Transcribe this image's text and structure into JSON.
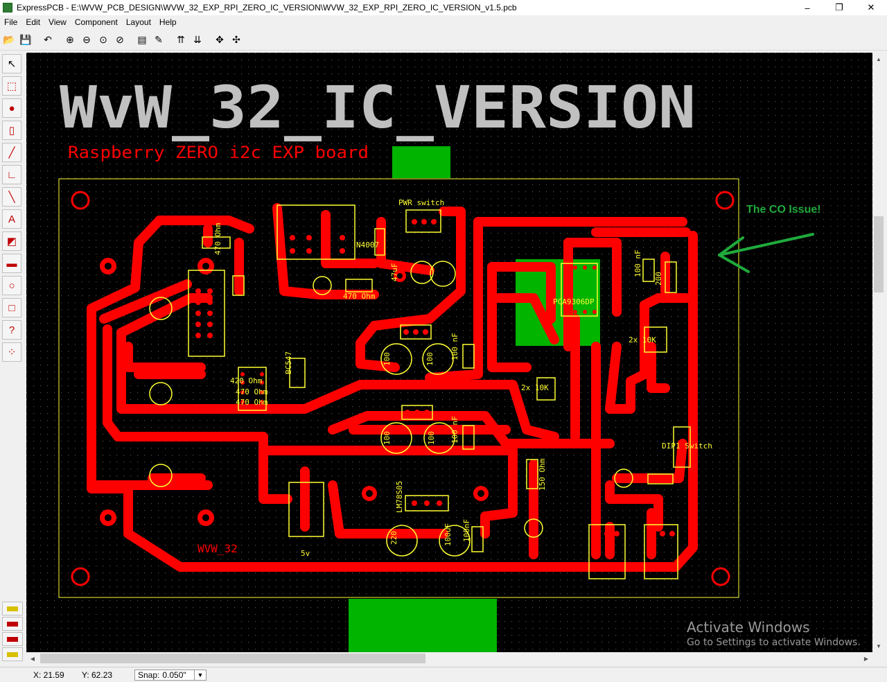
{
  "window": {
    "title": "ExpressPCB - E:\\WVW_PCB_DESIGN\\WVW_32_EXP_RPI_ZERO_IC_VERSION\\WVW_32_EXP_RPI_ZERO_IC_VERSION_v1.5.pcb",
    "minimize": "–",
    "maximize": "❐",
    "close": "✕"
  },
  "menu": [
    {
      "label": "File",
      "name": "menu-file"
    },
    {
      "label": "Edit",
      "name": "menu-edit"
    },
    {
      "label": "View",
      "name": "menu-view"
    },
    {
      "label": "Component",
      "name": "menu-component"
    },
    {
      "label": "Layout",
      "name": "menu-layout"
    },
    {
      "label": "Help",
      "name": "menu-help"
    }
  ],
  "toolbar": [
    {
      "icon": "open-folder-icon",
      "glyph": "📂"
    },
    {
      "icon": "save-icon",
      "glyph": "💾"
    },
    {
      "sep": true
    },
    {
      "icon": "undo-icon",
      "glyph": "↶"
    },
    {
      "sep": true
    },
    {
      "icon": "zoom-in-icon",
      "glyph": "⊕"
    },
    {
      "icon": "zoom-out-icon",
      "glyph": "⊖"
    },
    {
      "icon": "zoom-fit-icon",
      "glyph": "⊙"
    },
    {
      "icon": "zoom-previous-icon",
      "glyph": "⊘"
    },
    {
      "sep": true
    },
    {
      "icon": "properties-icon",
      "glyph": "▤"
    },
    {
      "icon": "edit-properties-icon",
      "glyph": "✎"
    },
    {
      "sep": true
    },
    {
      "icon": "top-layer-icon",
      "glyph": "⇈"
    },
    {
      "icon": "bottom-layer-icon",
      "glyph": "⇊"
    },
    {
      "sep": true
    },
    {
      "icon": "move-icon",
      "glyph": "✥"
    },
    {
      "icon": "move-component-icon",
      "glyph": "✣"
    }
  ],
  "left_tools": [
    {
      "icon": "select-arrow-icon",
      "glyph": "↖"
    },
    {
      "icon": "zoom-region-icon",
      "glyph": "⬚"
    },
    {
      "icon": "place-pad-icon",
      "glyph": "●"
    },
    {
      "icon": "place-component-icon",
      "glyph": "▯"
    },
    {
      "icon": "draw-trace-icon",
      "glyph": "╱"
    },
    {
      "icon": "draw-corner-trace-icon",
      "glyph": "∟"
    },
    {
      "icon": "draw-line-icon",
      "glyph": "╲"
    },
    {
      "icon": "place-text-icon",
      "glyph": "A"
    },
    {
      "icon": "filled-area-icon",
      "glyph": "◩"
    },
    {
      "icon": "copper-fill-icon",
      "glyph": "▬"
    },
    {
      "icon": "circle-icon",
      "glyph": "○"
    },
    {
      "icon": "rectangle-icon",
      "glyph": "□"
    },
    {
      "icon": "pad-info-icon",
      "glyph": "?"
    },
    {
      "icon": "netlist-icon",
      "glyph": "⁘"
    }
  ],
  "layer_buttons": [
    {
      "icon": "layer-top-silk-icon"
    },
    {
      "icon": "layer-top-copper-icon"
    },
    {
      "icon": "layer-bottom-copper-icon"
    },
    {
      "icon": "layer-bottom-silk-icon"
    }
  ],
  "board": {
    "silk_title": "WvW_32_IC_VERSION",
    "red_subtitle": "Raspberry ZERO i2c EXP board",
    "annotation": "The CO Issue!",
    "board_name_label": "WVW_32",
    "component_labels": {
      "r470_top": "470 Ohm",
      "n4007": "N4007",
      "pwr_switch": "PWR switch",
      "cap47uf": "47uF",
      "cap100nf_top": "100 nF",
      "r470_mid": "470 Ohm",
      "r200": "200",
      "pca": "PCA9306DP",
      "r10k_a": "2x 10K",
      "r10k_b": "2x 10K",
      "r420": "420 Ohm",
      "r470_a": "470 Ohm",
      "r470_b": "470 Ohm",
      "bc547": "BC547",
      "cap100_1": "100",
      "cap100_2": "100",
      "cap100nf_2": "100 nF",
      "cap100_3": "100",
      "cap100_4": "100",
      "cap100nf_3": "100 nF",
      "dip": "DIP1 Switch",
      "r150": "150 Ohm",
      "lm": "LM78S05",
      "cap220": "220",
      "cap100uf": "100uF",
      "cap100nf_4": "100nF",
      "five_v": "5v"
    }
  },
  "status": {
    "x_label": "X: 21.59",
    "y_label": "Y: 62.23",
    "snap_label": "Snap:",
    "snap_value": "0.050\"",
    "snap_arrow": "▼"
  },
  "watermark": {
    "line1": "Activate Windows",
    "line2": "Go to Settings to activate Windows."
  },
  "colors": {
    "copper_top": "#ff0000",
    "silkscreen_outline": "#ffff33",
    "silk_text": "#c0c0c0",
    "ground_fill": "#00b400",
    "annotation": "#1faa3c",
    "canvas": "#000000"
  }
}
